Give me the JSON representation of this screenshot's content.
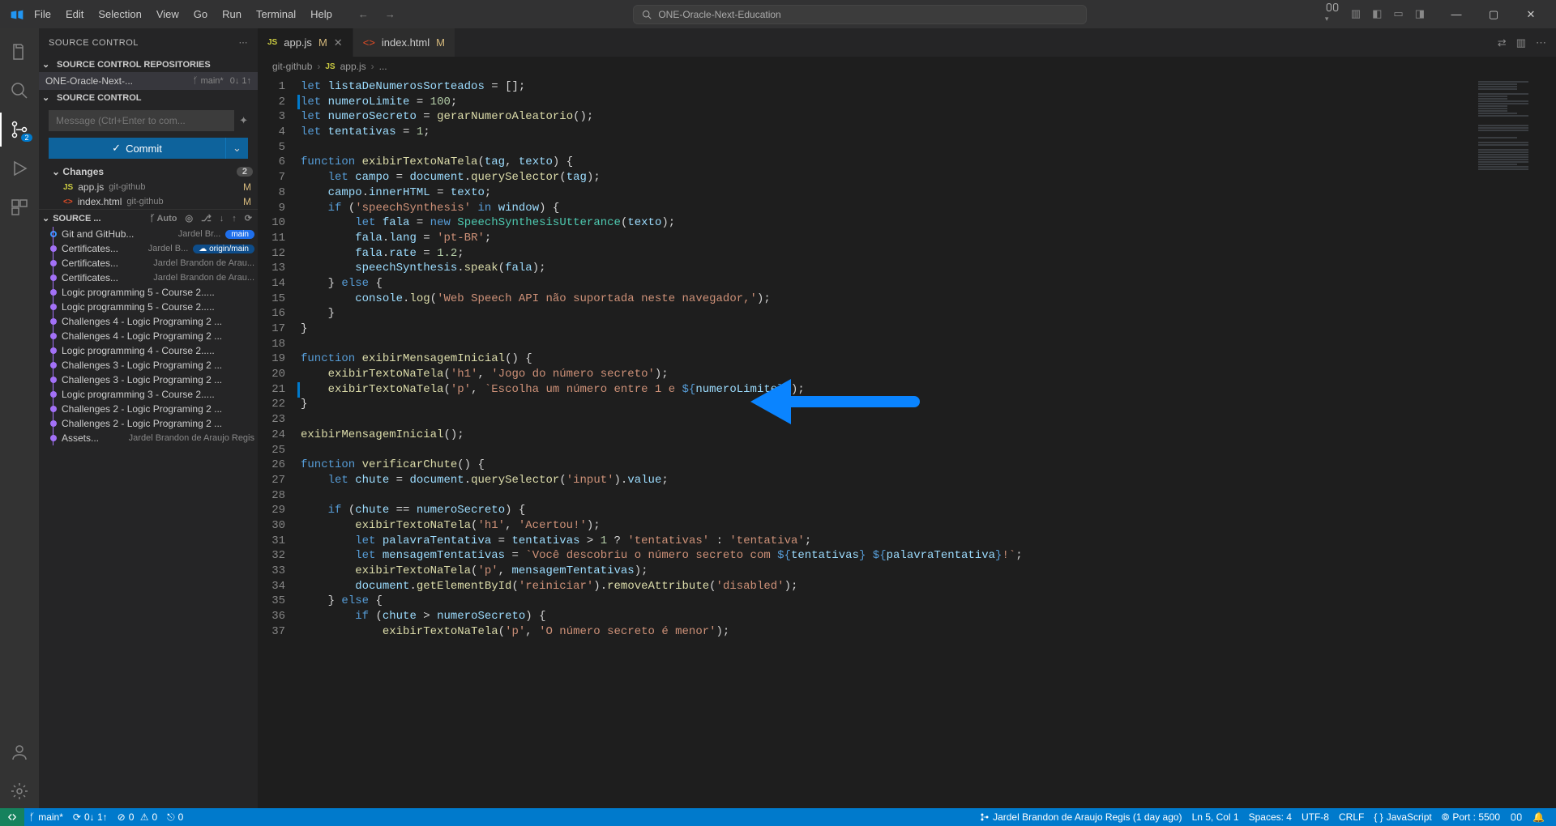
{
  "menu": [
    "File",
    "Edit",
    "Selection",
    "View",
    "Go",
    "Run",
    "Terminal",
    "Help"
  ],
  "search_label": "ONE-Oracle-Next-Education",
  "sidebar": {
    "title": "SOURCE CONTROL",
    "repos_header": "SOURCE CONTROL REPOSITORIES",
    "repo_name": "ONE-Oracle-Next-...",
    "repo_branch": "main*",
    "repo_sync": "0↓ 1↑",
    "scm_header": "SOURCE CONTROL",
    "message_placeholder": "Message (Ctrl+Enter to com...",
    "commit_label": "Commit",
    "changes_label": "Changes",
    "changes_count": "2",
    "files": [
      {
        "icon": "JS",
        "icon_class": "js",
        "name": "app.js",
        "folder": "git-github",
        "mod": "M"
      },
      {
        "icon": "<>",
        "icon_class": "html",
        "name": "index.html",
        "folder": "git-github",
        "mod": "M"
      }
    ],
    "graph_header": "SOURCE ...",
    "graph_auto": "Auto",
    "commits": [
      {
        "head": true,
        "msg": "Git and GitHub...",
        "auth": "Jardel Br...",
        "badge": "main",
        "badge_class": "badge-blue"
      },
      {
        "msg": "Certificates...",
        "auth": "Jardel B...",
        "badge": "origin/main",
        "badge_class": "badge-darkblue",
        "cloud": true
      },
      {
        "msg": "Certificates...",
        "auth": "Jardel Brandon de Arau..."
      },
      {
        "msg": "Certificates...",
        "auth": "Jardel Brandon de Arau..."
      },
      {
        "msg": "Logic programming 5 - Course 2.....",
        "auth": ""
      },
      {
        "msg": "Logic programming 5 - Course 2.....",
        "auth": ""
      },
      {
        "msg": "Challenges 4 - Logic Programing 2 ...",
        "auth": ""
      },
      {
        "msg": "Challenges 4 - Logic Programing 2 ...",
        "auth": ""
      },
      {
        "msg": "Logic programming 4 - Course 2.....",
        "auth": ""
      },
      {
        "msg": "Challenges 3 - Logic Programing 2 ...",
        "auth": ""
      },
      {
        "msg": "Challenges 3 - Logic Programing 2 ...",
        "auth": ""
      },
      {
        "msg": "Logic programming 3 - Course 2.....",
        "auth": ""
      },
      {
        "msg": "Challenges 2 - Logic Programing 2 ...",
        "auth": ""
      },
      {
        "msg": "Challenges 2 - Logic Programing 2 ...",
        "auth": ""
      },
      {
        "msg": "Assets...",
        "auth": "Jardel Brandon de Araujo Regis"
      }
    ]
  },
  "activitybar_badge": "2",
  "tabs": [
    {
      "icon": "JS",
      "icon_class": "js",
      "name": "app.js",
      "dirty": "M",
      "active": true,
      "close": true
    },
    {
      "icon": "<>",
      "icon_class": "html",
      "name": "index.html",
      "dirty": "M",
      "active": false
    }
  ],
  "breadcrumbs": [
    "git-github",
    "app.js",
    "..."
  ],
  "status": {
    "branch": "main*",
    "sync": "0↓ 1↑",
    "errors": "0",
    "warnings": "0",
    "port_forward": "0",
    "blame": "Jardel Brandon de Araujo Regis (1 day ago)",
    "ln": "Ln 5, Col 1",
    "spaces": "Spaces: 4",
    "enc": "UTF-8",
    "eol": "CRLF",
    "lang": "JavaScript",
    "port": "Port : 5500"
  },
  "lines": [
    {
      "n": 1,
      "html": "<span class='tok-kw'>let</span> <span class='tok-var'>listaDeNumerosSorteados</span> <span class='tok-op'>=</span> <span class='tok-pn'>[];</span>"
    },
    {
      "n": 2,
      "html": "<span class='tok-kw'>let</span> <span class='tok-var'>numeroLimite</span> <span class='tok-op'>=</span> <span class='tok-num'>100</span><span class='tok-pn'>;</span>",
      "blue": true
    },
    {
      "n": 3,
      "html": "<span class='tok-kw'>let</span> <span class='tok-var'>numeroSecreto</span> <span class='tok-op'>=</span> <span class='tok-fn'>gerarNumeroAleatorio</span><span class='tok-pn'>();</span>"
    },
    {
      "n": 4,
      "html": "<span class='tok-kw'>let</span> <span class='tok-var'>tentativas</span> <span class='tok-op'>=</span> <span class='tok-num'>1</span><span class='tok-pn'>;</span>"
    },
    {
      "n": 5,
      "html": ""
    },
    {
      "n": 6,
      "html": "<span class='tok-kw'>function</span> <span class='tok-fn'>exibirTextoNaTela</span><span class='tok-pn'>(</span><span class='tok-var'>tag</span><span class='tok-pn'>,</span> <span class='tok-var'>texto</span><span class='tok-pn'>) {</span>"
    },
    {
      "n": 7,
      "html": "    <span class='tok-kw'>let</span> <span class='tok-var'>campo</span> <span class='tok-op'>=</span> <span class='tok-var'>document</span><span class='tok-pn'>.</span><span class='tok-fn'>querySelector</span><span class='tok-pn'>(</span><span class='tok-var'>tag</span><span class='tok-pn'>);</span>"
    },
    {
      "n": 8,
      "html": "    <span class='tok-var'>campo</span><span class='tok-pn'>.</span><span class='tok-prop'>innerHTML</span> <span class='tok-op'>=</span> <span class='tok-var'>texto</span><span class='tok-pn'>;</span>"
    },
    {
      "n": 9,
      "html": "    <span class='tok-kw'>if</span> <span class='tok-pn'>(</span><span class='tok-str'>'speechSynthesis'</span> <span class='tok-kw'>in</span> <span class='tok-var'>window</span><span class='tok-pn'>) {</span>"
    },
    {
      "n": 10,
      "html": "        <span class='tok-kw'>let</span> <span class='tok-var'>fala</span> <span class='tok-op'>=</span> <span class='tok-kw'>new</span> <span class='tok-cls'>SpeechSynthesisUtterance</span><span class='tok-pn'>(</span><span class='tok-var'>texto</span><span class='tok-pn'>);</span>"
    },
    {
      "n": 11,
      "html": "        <span class='tok-var'>fala</span><span class='tok-pn'>.</span><span class='tok-prop'>lang</span> <span class='tok-op'>=</span> <span class='tok-str'>'pt-BR'</span><span class='tok-pn'>;</span>"
    },
    {
      "n": 12,
      "html": "        <span class='tok-var'>fala</span><span class='tok-pn'>.</span><span class='tok-prop'>rate</span> <span class='tok-op'>=</span> <span class='tok-num'>1.2</span><span class='tok-pn'>;</span>"
    },
    {
      "n": 13,
      "html": "        <span class='tok-var'>speechSynthesis</span><span class='tok-pn'>.</span><span class='tok-fn'>speak</span><span class='tok-pn'>(</span><span class='tok-var'>fala</span><span class='tok-pn'>);</span>"
    },
    {
      "n": 14,
      "html": "    <span class='tok-pn'>}</span> <span class='tok-kw'>else</span> <span class='tok-pn'>{</span>"
    },
    {
      "n": 15,
      "html": "        <span class='tok-var'>console</span><span class='tok-pn'>.</span><span class='tok-fn'>log</span><span class='tok-pn'>(</span><span class='tok-str'>'Web Speech API não suportada neste navegador,'</span><span class='tok-pn'>);</span>"
    },
    {
      "n": 16,
      "html": "    <span class='tok-pn'>}</span>"
    },
    {
      "n": 17,
      "html": "<span class='tok-pn'>}</span>"
    },
    {
      "n": 18,
      "html": ""
    },
    {
      "n": 19,
      "html": "<span class='tok-kw'>function</span> <span class='tok-fn'>exibirMensagemInicial</span><span class='tok-pn'>() {</span>"
    },
    {
      "n": 20,
      "html": "    <span class='tok-fn'>exibirTextoNaTela</span><span class='tok-pn'>(</span><span class='tok-str'>'h1'</span><span class='tok-pn'>,</span> <span class='tok-str'>'Jogo do número secreto'</span><span class='tok-pn'>);</span>"
    },
    {
      "n": 21,
      "html": "    <span class='tok-fn'>exibirTextoNaTela</span><span class='tok-pn'>(</span><span class='tok-str'>'p'</span><span class='tok-pn'>,</span> <span class='tok-str'>`Escolha um número entre 1 e </span><span class='tok-kw'>${</span><span class='tok-var'>numeroLimite</span><span class='tok-kw'>}</span><span class='tok-str'>`</span><span class='tok-pn'>);</span>",
      "blue": true
    },
    {
      "n": 22,
      "html": "<span class='tok-pn'>}</span>"
    },
    {
      "n": 23,
      "html": ""
    },
    {
      "n": 24,
      "html": "<span class='tok-fn'>exibirMensagemInicial</span><span class='tok-pn'>();</span>"
    },
    {
      "n": 25,
      "html": ""
    },
    {
      "n": 26,
      "html": "<span class='tok-kw'>function</span> <span class='tok-fn'>verificarChute</span><span class='tok-pn'>() {</span>"
    },
    {
      "n": 27,
      "html": "    <span class='tok-kw'>let</span> <span class='tok-var'>chute</span> <span class='tok-op'>=</span> <span class='tok-var'>document</span><span class='tok-pn'>.</span><span class='tok-fn'>querySelector</span><span class='tok-pn'>(</span><span class='tok-str'>'input'</span><span class='tok-pn'>).</span><span class='tok-prop'>value</span><span class='tok-pn'>;</span>"
    },
    {
      "n": 28,
      "html": ""
    },
    {
      "n": 29,
      "html": "    <span class='tok-kw'>if</span> <span class='tok-pn'>(</span><span class='tok-var'>chute</span> <span class='tok-op'>==</span> <span class='tok-var'>numeroSecreto</span><span class='tok-pn'>) {</span>"
    },
    {
      "n": 30,
      "html": "        <span class='tok-fn'>exibirTextoNaTela</span><span class='tok-pn'>(</span><span class='tok-str'>'h1'</span><span class='tok-pn'>,</span> <span class='tok-str'>'Acertou!'</span><span class='tok-pn'>);</span>"
    },
    {
      "n": 31,
      "html": "        <span class='tok-kw'>let</span> <span class='tok-var'>palavraTentativa</span> <span class='tok-op'>=</span> <span class='tok-var'>tentativas</span> <span class='tok-op'>&gt;</span> <span class='tok-num'>1</span> <span class='tok-op'>?</span> <span class='tok-str'>'tentativas'</span> <span class='tok-op'>:</span> <span class='tok-str'>'tentativa'</span><span class='tok-pn'>;</span>"
    },
    {
      "n": 32,
      "html": "        <span class='tok-kw'>let</span> <span class='tok-var'>mensagemTentativas</span> <span class='tok-op'>=</span> <span class='tok-str'>`Você descobriu o número secreto com </span><span class='tok-kw'>${</span><span class='tok-var'>tentativas</span><span class='tok-kw'>}</span><span class='tok-str'> </span><span class='tok-kw'>${</span><span class='tok-var'>palavraTentativa</span><span class='tok-kw'>}</span><span class='tok-str'>!`</span><span class='tok-pn'>;</span>"
    },
    {
      "n": 33,
      "html": "        <span class='tok-fn'>exibirTextoNaTela</span><span class='tok-pn'>(</span><span class='tok-str'>'p'</span><span class='tok-pn'>,</span> <span class='tok-var'>mensagemTentativas</span><span class='tok-pn'>);</span>"
    },
    {
      "n": 34,
      "html": "        <span class='tok-var'>document</span><span class='tok-pn'>.</span><span class='tok-fn'>getElementById</span><span class='tok-pn'>(</span><span class='tok-str'>'reiniciar'</span><span class='tok-pn'>).</span><span class='tok-fn'>removeAttribute</span><span class='tok-pn'>(</span><span class='tok-str'>'disabled'</span><span class='tok-pn'>);</span>"
    },
    {
      "n": 35,
      "html": "    <span class='tok-pn'>}</span> <span class='tok-kw'>else</span> <span class='tok-pn'>{</span>"
    },
    {
      "n": 36,
      "html": "        <span class='tok-kw'>if</span> <span class='tok-pn'>(</span><span class='tok-var'>chute</span> <span class='tok-op'>&gt;</span> <span class='tok-var'>numeroSecreto</span><span class='tok-pn'>) {</span>"
    },
    {
      "n": 37,
      "html": "            <span class='tok-fn'>exibirTextoNaTela</span><span class='tok-pn'>(</span><span class='tok-str'>'p'</span><span class='tok-pn'>,</span> <span class='tok-str'>'O número secreto é menor'</span><span class='tok-pn'>);</span>"
    }
  ]
}
